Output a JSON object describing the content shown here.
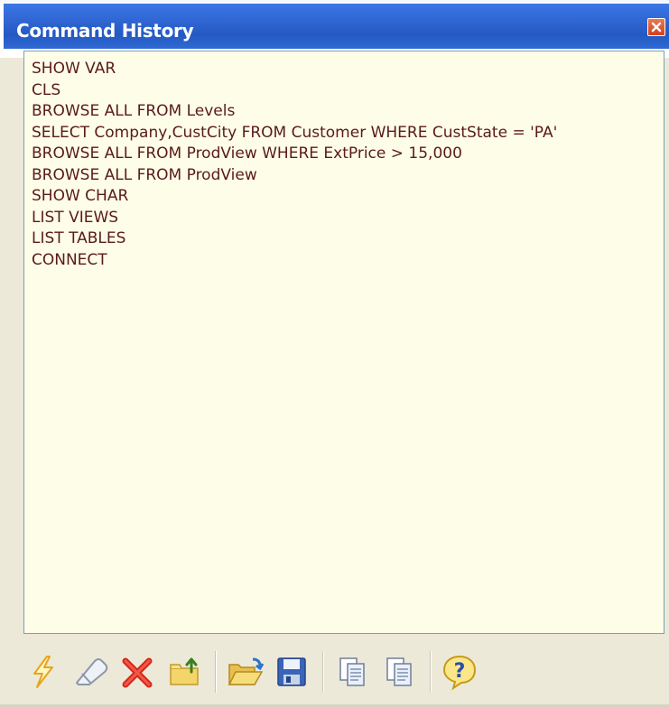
{
  "window": {
    "title": "Command History",
    "close_icon": "close-icon"
  },
  "history": {
    "items": [
      "SHOW VAR",
      "CLS",
      "BROWSE ALL FROM Levels",
      "SELECT Company,CustCity FROM Customer WHERE CustState = 'PA'",
      "BROWSE ALL FROM ProdView WHERE ExtPrice > 15,000",
      "BROWSE ALL FROM ProdView",
      "SHOW CHAR",
      "LIST VIEWS",
      "LIST TABLES",
      "CONNECT"
    ]
  },
  "toolbar": {
    "buttons": [
      {
        "icon": "lightning-icon"
      },
      {
        "icon": "eraser-icon"
      },
      {
        "icon": "delete-x-icon"
      },
      {
        "icon": "folder-up-icon"
      },
      {
        "icon": "open-folder-icon"
      },
      {
        "icon": "save-disk-icon"
      },
      {
        "icon": "copy-icon"
      },
      {
        "icon": "paste-icon"
      },
      {
        "icon": "help-icon"
      }
    ]
  },
  "colors": {
    "titlebar": "#2d63cf",
    "content_bg": "#fefee8",
    "text": "#5a1a1a",
    "close": "#d5401c"
  }
}
